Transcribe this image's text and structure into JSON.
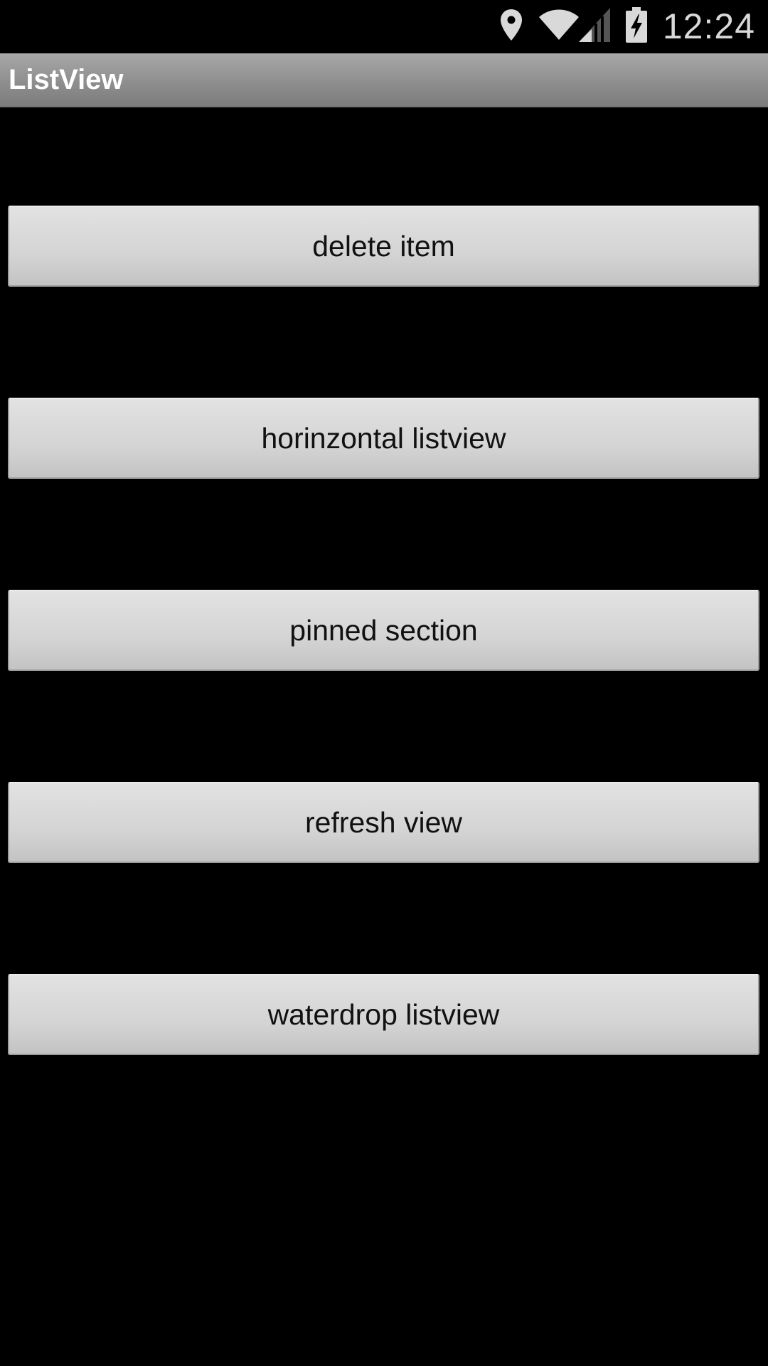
{
  "status_bar": {
    "time": "12:24",
    "icons": [
      "location-icon",
      "wifi-icon",
      "cell-signal-icon",
      "battery-charging-icon"
    ]
  },
  "action_bar": {
    "title": "ListView"
  },
  "buttons": [
    {
      "label": "delete item"
    },
    {
      "label": "horinzontal listview"
    },
    {
      "label": "pinned section"
    },
    {
      "label": "refresh view"
    },
    {
      "label": "waterdrop listview"
    }
  ]
}
